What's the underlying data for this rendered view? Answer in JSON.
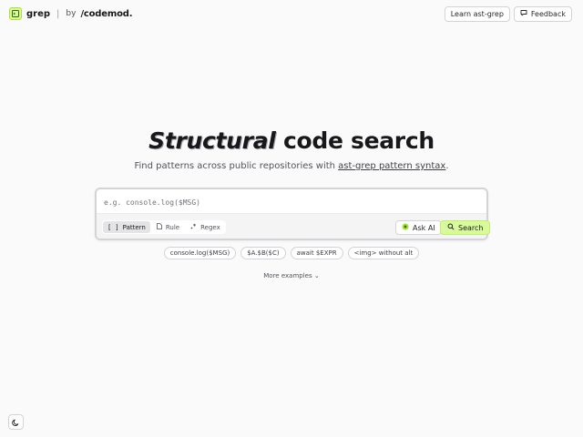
{
  "header": {
    "brand_name": "grep",
    "brand_separator": "|",
    "brand_by": "by",
    "brand_company": "/codemod.",
    "learn_label": "Learn ast-grep",
    "feedback_label": "Feedback"
  },
  "hero": {
    "title_emphasis": "Structural",
    "title_rest": " code search",
    "subtitle_prefix": "Find patterns across public repositories with ",
    "subtitle_link": "ast-grep pattern syntax",
    "subtitle_suffix": "."
  },
  "search": {
    "placeholder": "e.g. console.log($MSG)",
    "value": "",
    "modes": [
      {
        "label": "Pattern",
        "icon": "brackets-icon",
        "active": true
      },
      {
        "label": "Rule",
        "icon": "file-icon",
        "active": false
      },
      {
        "label": "Regex",
        "icon": "regex-icon",
        "active": false
      }
    ],
    "ask_ai_label": "Ask AI",
    "search_label": "Search"
  },
  "examples": {
    "chips": [
      "console.log($MSG)",
      "$A.$B($C)",
      "await $EXPR",
      "<img> without alt"
    ],
    "more_label": "More examples"
  },
  "colors": {
    "accent": "#d9f99d",
    "background": "#fafafa"
  }
}
